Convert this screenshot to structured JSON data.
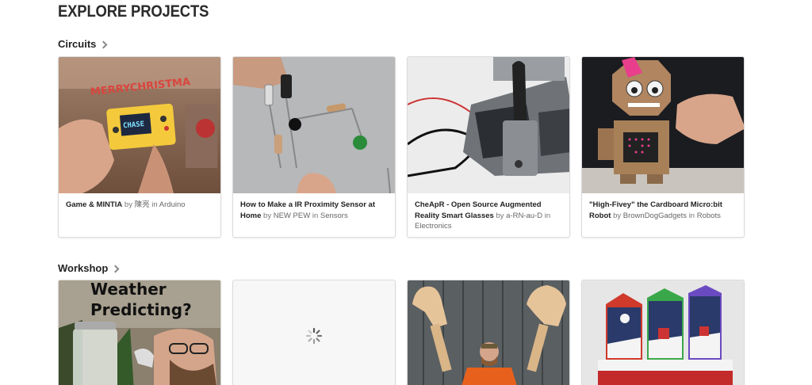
{
  "page": {
    "title": "EXPLORE PROJECTS"
  },
  "sections": [
    {
      "name": "Circuits",
      "cards": [
        {
          "title": "Game & MINTIA",
          "by": "by",
          "author": "陳亮",
          "in": "in",
          "category": "Arduino",
          "thumb_text": "CHASE"
        },
        {
          "title": "How to Make a IR Proximity Sensor at Home",
          "by": "by",
          "author": "NEW PEW",
          "in": "in",
          "category": "Sensors"
        },
        {
          "title": "CheApR - Open Source Augmented Reality Smart Glasses",
          "by": "by",
          "author": "a-RN-au-D",
          "in": "in",
          "category": "Electronics"
        },
        {
          "title": "\"High-Fivey\" the Cardboard Micro:bit Robot",
          "by": "by",
          "author": "BrownDogGadgets",
          "in": "in",
          "category": "Robots"
        }
      ]
    },
    {
      "name": "Workshop",
      "cards": [
        {
          "thumb_text_line1": "Weather",
          "thumb_text_line2": "Predicting?"
        },
        {
          "loading": true
        },
        {},
        {}
      ]
    }
  ],
  "colors": {
    "accent_pink": "#e83e8c",
    "card_border": "#dcdcdc"
  }
}
